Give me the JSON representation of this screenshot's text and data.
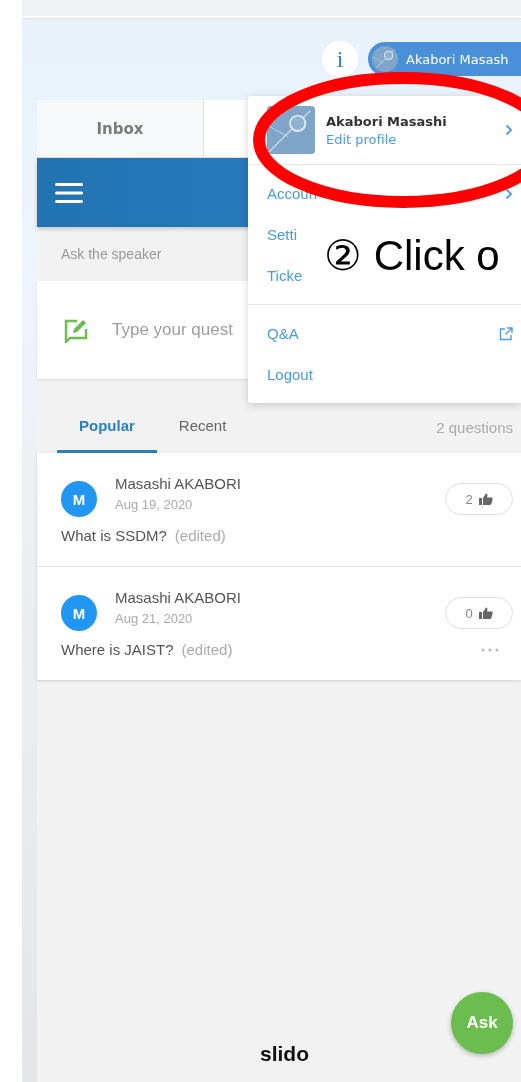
{
  "header": {
    "info_label": "i",
    "user_name": "Akabori Masash"
  },
  "tabs": [
    {
      "label": "Inbox",
      "selected": false
    }
  ],
  "ask": {
    "section_label": "Ask the speaker",
    "placeholder": "Type your quest"
  },
  "sort_tabs": [
    {
      "label": "Popular",
      "selected": true
    },
    {
      "label": "Recent",
      "selected": false
    }
  ],
  "question_count": "2 questions",
  "questions": [
    {
      "author_initial": "M",
      "author": "Masashi AKABORI",
      "date": "Aug 19, 2020",
      "text": "What is SSDM?",
      "edited": "(edited)",
      "votes": "2",
      "more_button": false
    },
    {
      "author_initial": "M",
      "author": "Masashi AKABORI",
      "date": "Aug 21, 2020",
      "text": "Where is JAIST?",
      "edited": "(edited)",
      "votes": "0",
      "more_button": true
    }
  ],
  "footer": {
    "logo": "slido",
    "ask_button": "Ask"
  },
  "user_menu": {
    "name": "Akabori Masashi",
    "edit_link": "Edit profile",
    "groups": [
      [
        {
          "label": "Accoun",
          "kind": "submenu"
        },
        {
          "label": "Setti",
          "kind": "plain"
        },
        {
          "label": "Ticke",
          "kind": "plain"
        }
      ],
      [
        {
          "label": "Q&A",
          "kind": "external"
        },
        {
          "label": "Logout",
          "kind": "plain"
        }
      ]
    ]
  },
  "annotation": {
    "text": "② Click o"
  }
}
